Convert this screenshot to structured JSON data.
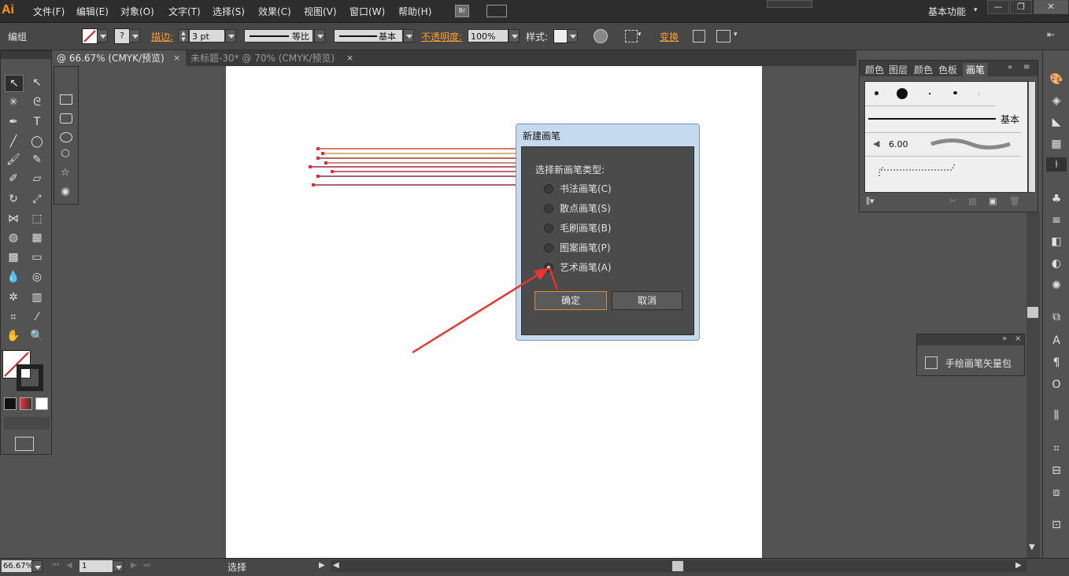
{
  "app": {
    "logo": "Ai",
    "workspace": "基本功能",
    "menu": [
      "文件(F)",
      "编辑(E)",
      "对象(O)",
      "文字(T)",
      "选择(S)",
      "效果(C)",
      "视图(V)",
      "窗口(W)",
      "帮助(H)"
    ],
    "bridge_label": "Br"
  },
  "controlbar": {
    "selection_type": "编组",
    "stroke_label": "描边:",
    "stroke_weight": "3 pt",
    "profile_label": "等比",
    "brush_label": "基本",
    "opacity_label": "不透明度:",
    "opacity_value": "100%",
    "style_label": "样式:",
    "transform_label": "变换"
  },
  "tabs": [
    {
      "label": "@ 66.67% (CMYK/预览)",
      "active": true
    },
    {
      "label": "未标题-30* @ 70% (CMYK/预览)",
      "active": false
    }
  ],
  "dialog": {
    "title": "新建画笔",
    "prompt": "选择新画笔类型:",
    "options": [
      {
        "label": "书法画笔(C)",
        "selected": false
      },
      {
        "label": "散点画笔(S)",
        "selected": false
      },
      {
        "label": "毛刷画笔(B)",
        "selected": false
      },
      {
        "label": "图案画笔(P)",
        "selected": false
      },
      {
        "label": "艺术画笔(A)",
        "selected": true
      }
    ],
    "ok_label": "确定",
    "cancel_label": "取消"
  },
  "brush_panel": {
    "tabs": [
      "颜色",
      "图层",
      "颜色",
      "色板",
      "画笔"
    ],
    "active_tab": "画笔",
    "basic_label": "基本",
    "size_value": "6.00"
  },
  "library_panel": {
    "item_label": "手绘画笔矢量包"
  },
  "statusbar": {
    "zoom": "66.67%",
    "page": "1",
    "mode": "选择"
  },
  "colors": {
    "artboard": "#ffffff",
    "accent_orange": "#ff9d2e",
    "arrow_red": "#e8352f",
    "dialog_frame": "#c5d9ef",
    "ui_dark": "#535353"
  },
  "artwork_lines": [
    "#d0503a",
    "#c8a050",
    "#a03830",
    "#c06048",
    "#9a2c40",
    "#b83050",
    "#803040",
    "#a02838"
  ]
}
